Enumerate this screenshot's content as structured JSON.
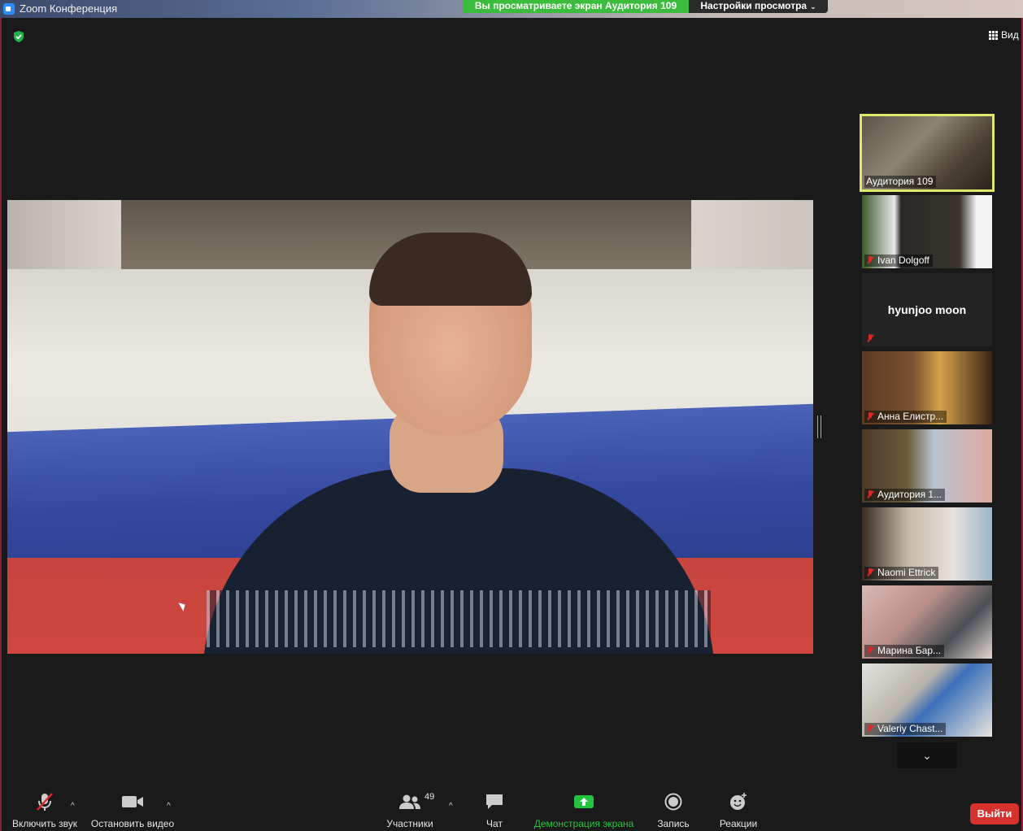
{
  "window": {
    "title": "Zoom Конференция"
  },
  "share_banner": {
    "text": "Вы просматриваете экран Аудитория 109",
    "options_label": "Настройки просмотра"
  },
  "top_right": {
    "view_label": "Вид"
  },
  "colors": {
    "share_green": "#3cbc3c",
    "active_speaker_border": "#dfe86b",
    "exit_red": "#d6312c",
    "muted_red": "#e02828"
  },
  "gallery": [
    {
      "name": "Аудитория 109",
      "muted": false,
      "active": true
    },
    {
      "name": "Ivan Dolgoff",
      "muted": true,
      "active": false
    },
    {
      "name": "hyunjoo moon",
      "muted": true,
      "active": false,
      "video_off": true
    },
    {
      "name": "Анна Елистр...",
      "muted": true,
      "active": false
    },
    {
      "name": "Аудитория 1...",
      "muted": true,
      "active": false
    },
    {
      "name": "Naomi Ettrick",
      "muted": true,
      "active": false
    },
    {
      "name": "Марина Бар...",
      "muted": true,
      "active": false
    },
    {
      "name": "Valeriy Chast...",
      "muted": true,
      "active": false
    }
  ],
  "toolbar": {
    "unmute_label": "Включить звук",
    "stop_video_label": "Остановить видео",
    "participants_label": "Участники",
    "participants_count": "49",
    "chat_label": "Чат",
    "share_label": "Демонстрация экрана",
    "record_label": "Запись",
    "reactions_label": "Реакции",
    "exit_label": "Выйти"
  }
}
